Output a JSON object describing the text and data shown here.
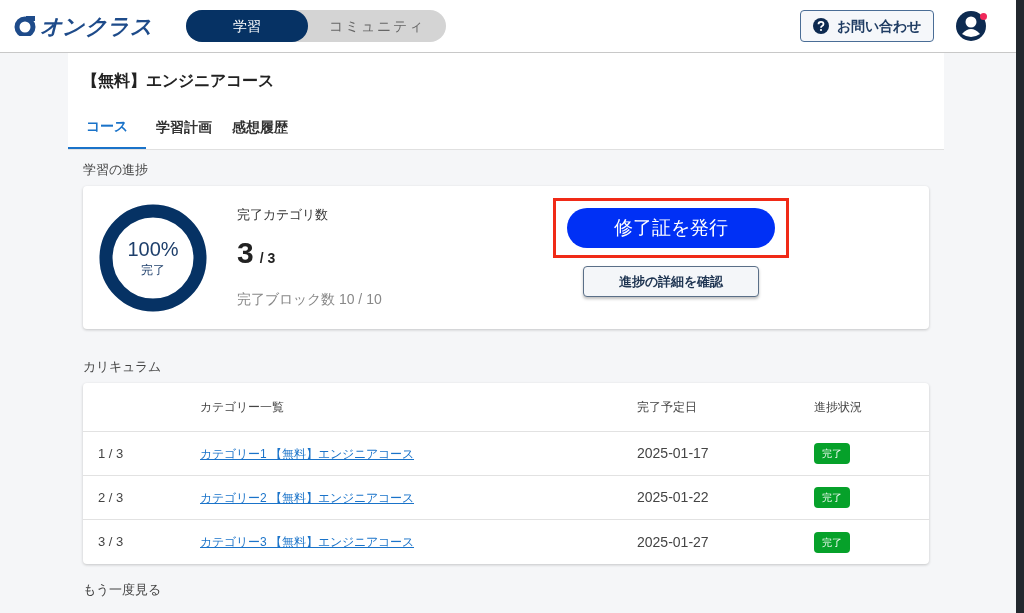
{
  "header": {
    "logo": "オンクラス",
    "mode_tabs": [
      {
        "label": "学習",
        "selected": true
      },
      {
        "label": "コミュニティ",
        "selected": false
      }
    ],
    "contact_button": "お問い合わせ",
    "notification": true
  },
  "course": {
    "title": "【無料】エンジニアコース",
    "tabs": [
      {
        "label": "コース",
        "selected": true
      },
      {
        "label": "学習計画",
        "selected": false
      },
      {
        "label": "感想履歴",
        "selected": false
      }
    ]
  },
  "progress": {
    "heading": "学習の進捗",
    "level": 1.0,
    "percent": "100%",
    "percent_caption": "完了",
    "category_label": "完了カテゴリ数",
    "category_done": "3",
    "category_total": "/ 3",
    "blocks": "完了ブロック数 10 / 10",
    "certificate_button": "修了証を発行",
    "certificate_highlighted": true,
    "details_button": "進捗の詳細を確認"
  },
  "curriculum": {
    "heading": "カリキュラム",
    "columns": [
      "カテゴリー一覧",
      "完了予定日",
      "進捗状況"
    ],
    "rows": [
      {
        "index": "1 / 3",
        "category": "カテゴリー1 【無料】エンジニアコース",
        "date": "2025-01-17",
        "status": "完了",
        "color": "#06a12a"
      },
      {
        "index": "2 / 3",
        "category": "カテゴリー2 【無料】エンジニアコース",
        "date": "2025-01-22",
        "status": "完了",
        "color": "#06a12a"
      },
      {
        "index": "3 / 3",
        "category": "カテゴリー3 【無料】エンジニアコース",
        "date": "2025-01-27",
        "status": "完了",
        "color": "#06a12a"
      }
    ]
  },
  "next_heading": "もう一度見る"
}
